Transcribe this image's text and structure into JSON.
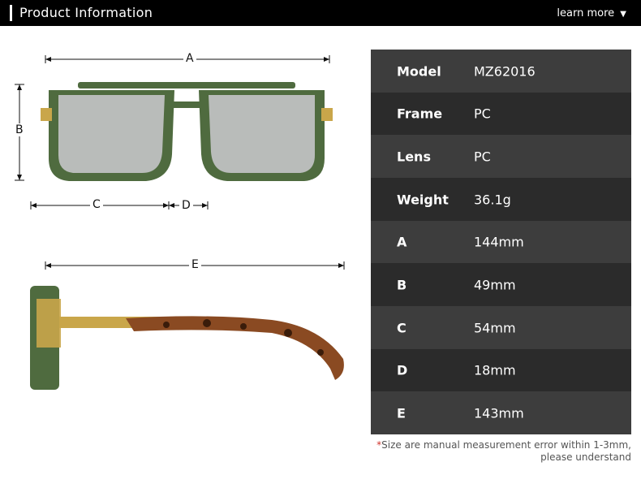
{
  "header": {
    "title": "Product Information",
    "learn_more": "learn more",
    "chevron": "▼"
  },
  "dimensions": {
    "A": "A",
    "B": "B",
    "C": "C",
    "D": "D",
    "E": "E"
  },
  "specs": [
    {
      "key": "Model",
      "value": "MZ62016"
    },
    {
      "key": "Frame",
      "value": "PC"
    },
    {
      "key": "Lens",
      "value": "PC"
    },
    {
      "key": "Weight",
      "value": "36.1g"
    },
    {
      "key": "A",
      "value": "144mm"
    },
    {
      "key": "B",
      "value": "49mm"
    },
    {
      "key": "C",
      "value": "54mm"
    },
    {
      "key": "D",
      "value": "18mm"
    },
    {
      "key": "E",
      "value": "143mm"
    }
  ],
  "note": {
    "star": "*",
    "line1": "Size are manual measurement error within 1-3mm,",
    "line2": "please understand"
  },
  "colors": {
    "frame_green": "#4f6b3f",
    "lens_gray": "#b9bcba",
    "tortoise": "#8a4a22",
    "gold": "#c9a64a"
  }
}
